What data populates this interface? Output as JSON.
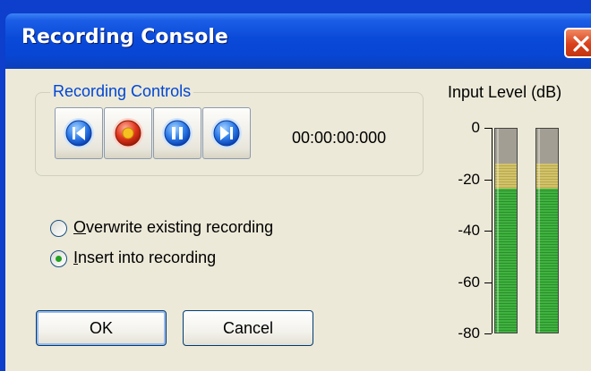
{
  "window": {
    "title": "Recording Console"
  },
  "recording_controls": {
    "group_label": "Recording Controls",
    "buttons": [
      {
        "name": "rewind",
        "icon": "skip-back-icon"
      },
      {
        "name": "record",
        "icon": "record-icon"
      },
      {
        "name": "pause",
        "icon": "pause-icon"
      },
      {
        "name": "forward",
        "icon": "skip-forward-icon"
      }
    ],
    "timecode": "00:00:00:000"
  },
  "options": {
    "overwrite": {
      "label_prefix": "",
      "label_accel": "O",
      "label_rest": "verwrite existing recording",
      "checked": false
    },
    "insert": {
      "label_prefix": "",
      "label_accel": "I",
      "label_rest": "nsert into recording",
      "checked": true
    }
  },
  "buttons": {
    "ok": "OK",
    "cancel": "Cancel"
  },
  "meter": {
    "title": "Input Level (dB)",
    "ticks": [
      "0",
      "-20",
      "-40",
      "-60",
      "-80"
    ],
    "channels": [
      {
        "level_fraction": 0.7,
        "peak_fraction": 0.82
      },
      {
        "level_fraction": 0.7,
        "peak_fraction": 0.82
      }
    ]
  },
  "colors": {
    "titlebar": "#0a4ad8",
    "face": "#ece9d8",
    "accent": "#0046d5",
    "meter_green": "#3fb23f",
    "meter_yellow": "#d2c36a",
    "meter_gray": "#a39e93",
    "close": "#d9411c"
  }
}
